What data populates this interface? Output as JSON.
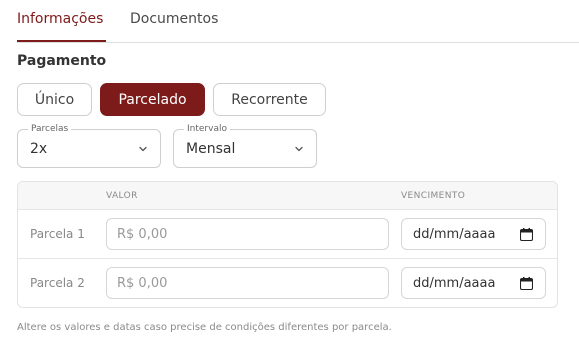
{
  "tabs": [
    {
      "label": "Informações",
      "active": true
    },
    {
      "label": "Documentos",
      "active": false
    }
  ],
  "section": {
    "title": "Pagamento"
  },
  "payment_types": [
    {
      "label": "Único",
      "active": false
    },
    {
      "label": "Parcelado",
      "active": true
    },
    {
      "label": "Recorrente",
      "active": false
    }
  ],
  "selects": {
    "parcelas": {
      "legend": "Parcelas",
      "value": "2x"
    },
    "intervalo": {
      "legend": "Intervalo",
      "value": "Mensal"
    }
  },
  "table": {
    "headers": {
      "valor": "VALOR",
      "vencimento": "VENCIMENTO"
    },
    "rows": [
      {
        "label": "Parcela 1",
        "valor_placeholder": "R$ 0,00",
        "valor_value": "",
        "date_placeholder": "dd/mm/aaaa"
      },
      {
        "label": "Parcela 2",
        "valor_placeholder": "R$ 0,00",
        "valor_value": "",
        "date_placeholder": "dd/mm/aaaa"
      }
    ]
  },
  "footnote": "Altere os valores e datas caso precise de condições diferentes por parcela.",
  "colors": {
    "accent": "#7d1a1a",
    "border": "#cfcfcf",
    "muted_text": "#8a8a8a"
  },
  "icons": {
    "select_arrow": "chevron-down-icon",
    "date_picker": "calendar-icon"
  }
}
